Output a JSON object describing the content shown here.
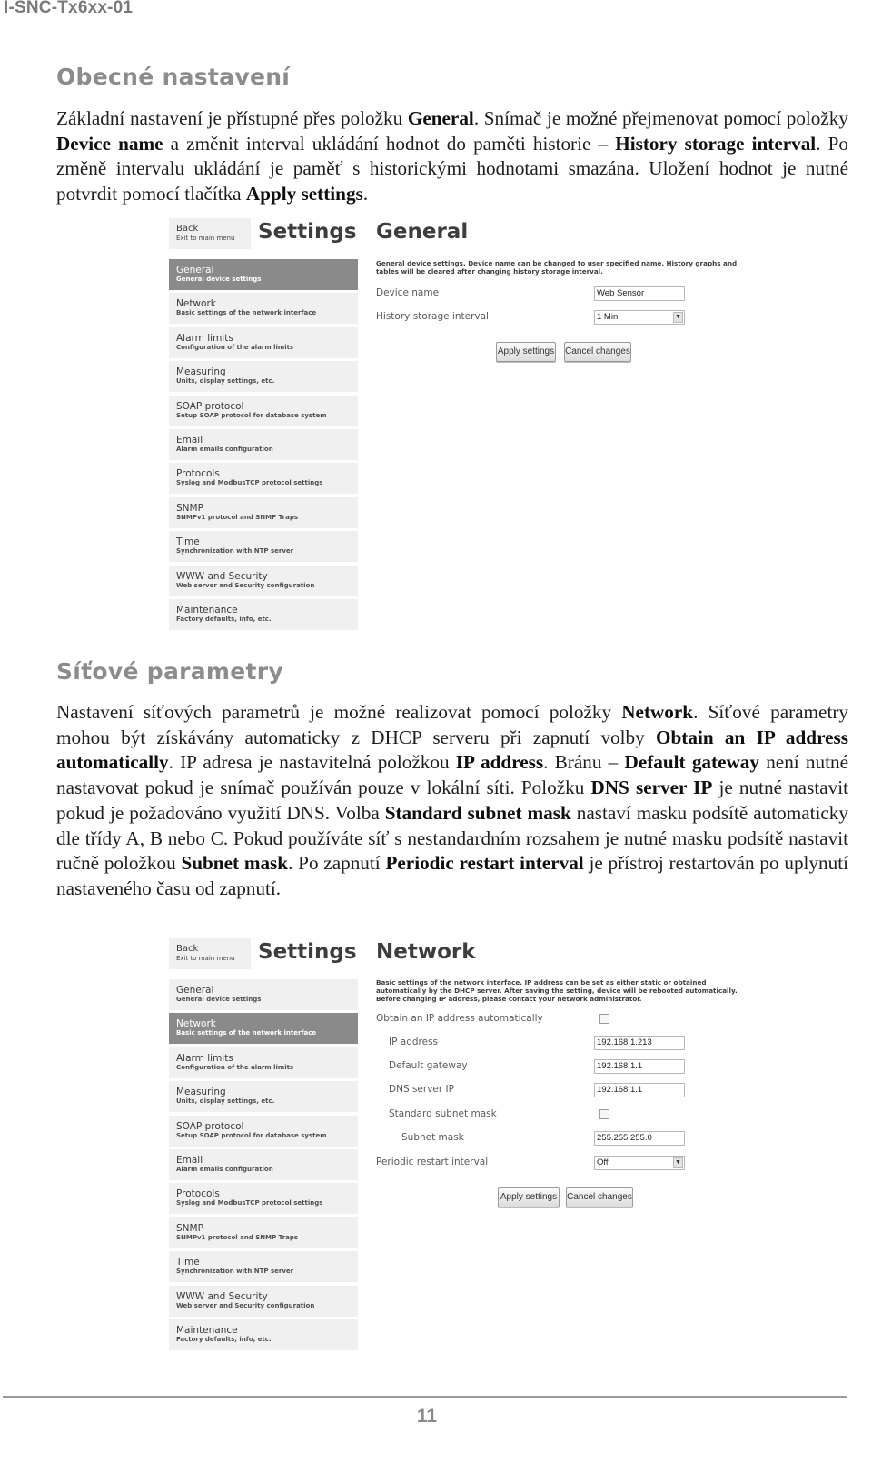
{
  "document": {
    "header": "I-SNC-Tx6xx-01",
    "page_number": "11"
  },
  "section_general": {
    "heading": "Obecné nastavení",
    "paragraph": [
      {
        "t": "Základní nastavení je přístupné přes položku "
      },
      {
        "b": "General"
      },
      {
        "t": ". Snímač je možné přejmenovat pomocí položky "
      },
      {
        "b": "Device name"
      },
      {
        "t": " a změnit interval ukládání hodnot do paměti historie – "
      },
      {
        "b": "History storage interval"
      },
      {
        "t": ". Po změně intervalu ukládání je paměť s historickými hodnotami smazána. Uložení hodnot je nutné potvrdit pomocí tlačítka "
      },
      {
        "b": "Apply settings"
      },
      {
        "t": "."
      }
    ]
  },
  "section_network": {
    "heading": "Síťové parametry",
    "paragraph": [
      {
        "t": "Nastavení síťových parametrů je možné realizovat pomocí položky "
      },
      {
        "b": "Network"
      },
      {
        "t": ". Síťové parametry mohou být získávány automaticky z DHCP serveru při zapnutí volby "
      },
      {
        "b": "Obtain an IP address automatically"
      },
      {
        "t": ". IP adresa je nastavitelná položkou "
      },
      {
        "b": "IP address"
      },
      {
        "t": ". Bránu – "
      },
      {
        "b": "Default gateway"
      },
      {
        "t": " není nutné nastavovat pokud je snímač používán pouze v lokální síti. Položku "
      },
      {
        "b": "DNS server IP"
      },
      {
        "t": " je nutné nastavit pokud je požadováno využití DNS. Volba "
      },
      {
        "b": "Standard subnet mask"
      },
      {
        "t": " nastaví masku podsítě automaticky dle třídy A, B nebo C. Pokud používáte síť s nestandardním rozsahem je nutné masku podsítě nastavit ručně položkou "
      },
      {
        "b": "Subnet mask"
      },
      {
        "t": ". Po zapnutí "
      },
      {
        "b": "Periodic restart interval"
      },
      {
        "t": " je přístroj restartován po uplynutí nastaveného času od zapnutí."
      }
    ]
  },
  "settings_ui": {
    "back": {
      "label": "Back",
      "sub": "Exit to main menu"
    },
    "title": "Settings",
    "menu": [
      {
        "label": "General",
        "sub": "General device settings"
      },
      {
        "label": "Network",
        "sub": "Basic settings of the network interface"
      },
      {
        "label": "Alarm limits",
        "sub": "Configuration of the alarm limits"
      },
      {
        "label": "Measuring",
        "sub": "Units, display settings, etc."
      },
      {
        "label": "SOAP protocol",
        "sub": "Setup SOAP protocol for database system"
      },
      {
        "label": "Email",
        "sub": "Alarm emails configuration"
      },
      {
        "label": "Protocols",
        "sub": "Syslog and ModbusTCP protocol settings"
      },
      {
        "label": "SNMP",
        "sub": "SNMPv1 protocol and SNMP Traps"
      },
      {
        "label": "Time",
        "sub": "Synchronization with NTP server"
      },
      {
        "label": "WWW and Security",
        "sub": "Web server and Security configuration"
      },
      {
        "label": "Maintenance",
        "sub": "Factory defaults, info, etc."
      }
    ],
    "apply_label": "Apply settings",
    "cancel_label": "Cancel changes"
  },
  "general_panel": {
    "active_menu": "General",
    "title": "General",
    "description": "General device settings. Device name can be changed to user specified name. History graphs and tables will be cleared after changing history storage interval.",
    "fields": {
      "device_name": {
        "label": "Device name",
        "value": "Web Sensor"
      },
      "history_interval": {
        "label": "History storage interval",
        "value": "1 Min"
      }
    }
  },
  "network_panel": {
    "active_menu": "Network",
    "title": "Network",
    "description": "Basic settings of the network interface. IP address can be set as either static or obtained automatically by the DHCP server. After saving the setting, device will be rebooted automatically. Before changing IP address, please contact your network administrator.",
    "fields": {
      "obtain_auto": {
        "label": "Obtain an IP address automatically",
        "checked": false
      },
      "ip_address": {
        "label": "IP address",
        "value": "192.168.1.213"
      },
      "gateway": {
        "label": "Default gateway",
        "value": "192.168.1.1"
      },
      "dns": {
        "label": "DNS server IP",
        "value": "192.168.1.1"
      },
      "std_mask": {
        "label": "Standard subnet mask",
        "checked": false
      },
      "subnet_mask": {
        "label": "Subnet mask",
        "value": "255.255.255.0"
      },
      "restart_interval": {
        "label": "Periodic restart interval",
        "value": "Off"
      }
    }
  }
}
